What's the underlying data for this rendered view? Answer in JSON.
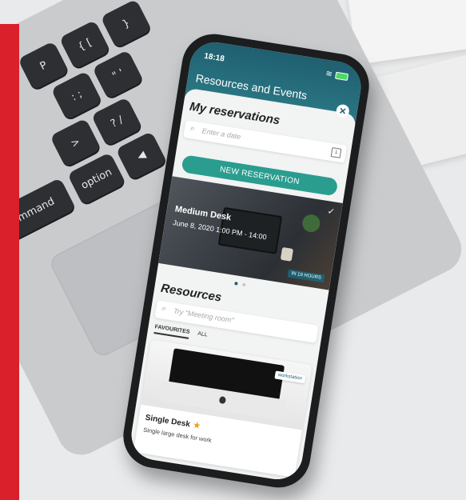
{
  "status_bar": {
    "time": "18:18"
  },
  "header": {
    "title": "Resources and Events",
    "close_icon": "close-icon"
  },
  "reservations": {
    "heading": "My reservations",
    "search_placeholder": "Enter a date",
    "calendar_icon_text": "1",
    "new_button_label": "NEW RESERVATION",
    "card": {
      "title": "Medium Desk",
      "date": "June 8, 2020 1:00 PM - 14:00",
      "badge": "IN 19 HOURS"
    }
  },
  "resources": {
    "heading": "Resources",
    "search_placeholder": "Try \"Meeting room\"",
    "tabs": [
      {
        "label": "FAVOURITES",
        "active": true
      },
      {
        "label": "ALL",
        "active": false
      }
    ],
    "card": {
      "tag": "workstation",
      "name": "Single Desk",
      "description": "Single large desk for work"
    }
  },
  "keyboard_keys": [
    "P",
    "{ [",
    "}",
    ": ;",
    "\" '",
    "? /",
    ">",
    "option",
    "mmand",
    "◀"
  ],
  "colors": {
    "accent": "#2a9d8f",
    "header": "#1f5f70",
    "brand_red": "#d9202b",
    "star": "#f0a020"
  }
}
